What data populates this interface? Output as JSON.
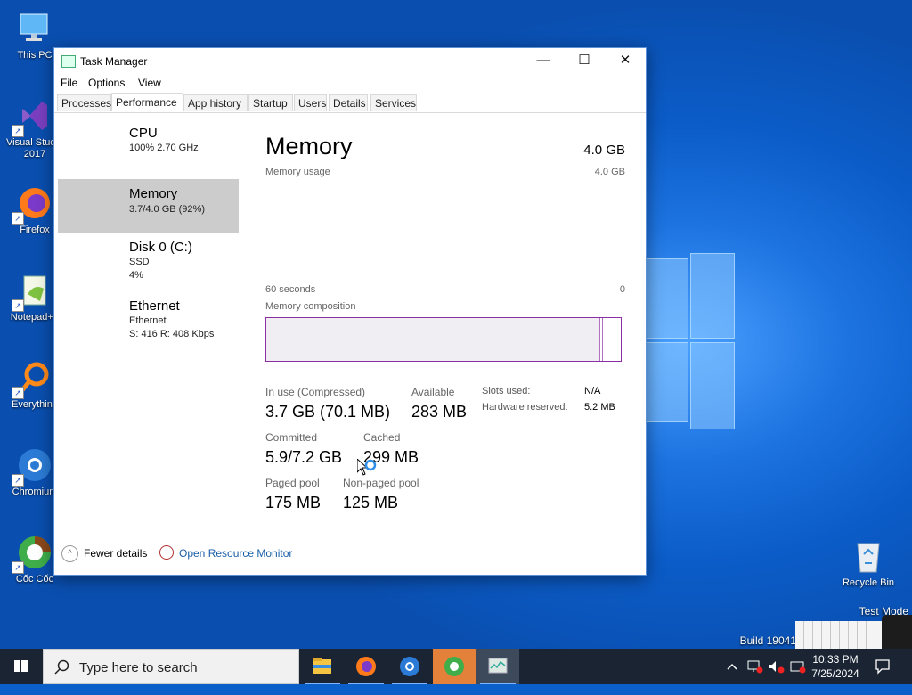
{
  "desktop": {
    "icons": [
      {
        "label": "This PC",
        "icon": "computer-icon"
      },
      {
        "label": "Visual Studio 2017",
        "icon": "visual-studio-icon"
      },
      {
        "label": "Firefox",
        "icon": "firefox-icon"
      },
      {
        "label": "Notepad++",
        "icon": "notepadpp-icon"
      },
      {
        "label": "Everything",
        "icon": "everything-icon"
      },
      {
        "label": "Chromium",
        "icon": "chromium-icon"
      },
      {
        "label": "Cốc Cốc",
        "icon": "coccoc-icon"
      }
    ],
    "recycle_bin": "Recycle Bin",
    "watermark_line1": "Test Mode",
    "watermark_line2": "Build 19041"
  },
  "task_manager": {
    "title": "Task Manager",
    "menu": [
      "File",
      "Options",
      "View"
    ],
    "tabs": [
      "Processes",
      "Performance",
      "App history",
      "Startup",
      "Users",
      "Details",
      "Services"
    ],
    "active_tab": "Performance",
    "sidebar": [
      {
        "title": "CPU",
        "line1": "100%  2.70 GHz",
        "line2": ""
      },
      {
        "title": "Memory",
        "line1": "3.7/4.0 GB (92%)",
        "line2": ""
      },
      {
        "title": "Disk 0 (C:)",
        "line1": "SSD",
        "line2": "4%"
      },
      {
        "title": "Ethernet",
        "line1": "Ethernet",
        "line2": "S: 416  R: 408 Kbps"
      }
    ],
    "selected_sidebar": "Memory",
    "main": {
      "heading": "Memory",
      "total": "4.0 GB",
      "usage_label": "Memory usage",
      "usage_max": "4.0 GB",
      "time_label": "60 seconds",
      "time_zero": "0",
      "composition_label": "Memory composition",
      "in_use_label": "In use (Compressed)",
      "in_use_value": "3.7 GB (70.1 MB)",
      "available_label": "Available",
      "available_value": "283 MB",
      "slots_label": "Slots used:",
      "slots_value": "N/A",
      "hw_reserved_label": "Hardware reserved:",
      "hw_reserved_value": "5.2 MB",
      "committed_label": "Committed",
      "committed_value": "5.9/7.2 GB",
      "cached_label": "Cached",
      "cached_value": "299 MB",
      "paged_label": "Paged pool",
      "paged_value": "175 MB",
      "nonpaged_label": "Non-paged pool",
      "nonpaged_value": "125 MB"
    },
    "footer": {
      "fewer_details": "Fewer details",
      "open_resource_monitor": "Open Resource Monitor"
    }
  },
  "taskbar": {
    "search_placeholder": "Type here to search",
    "apps": [
      "file-explorer-icon",
      "firefox-icon",
      "chromium-icon",
      "coccoc-icon",
      "task-manager-icon"
    ],
    "time": "10:33 PM",
    "date": "7/25/2024"
  }
}
